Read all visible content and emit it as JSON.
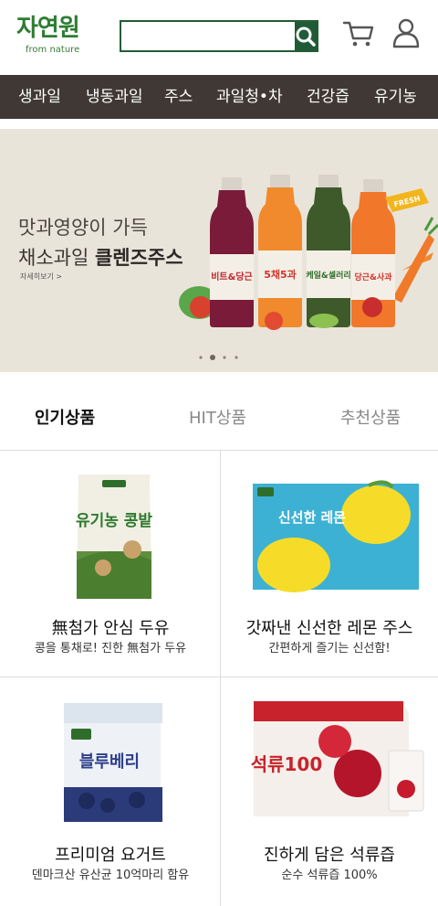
{
  "header": {
    "logo_main": "자연원",
    "logo_sub": "from nature",
    "search_placeholder": "",
    "search_value": ""
  },
  "nav": {
    "items": [
      "생과일",
      "냉동과일",
      "주스",
      "과일청•차",
      "건강즙",
      "유기농"
    ]
  },
  "banner": {
    "line1": "맛과영양이 가득",
    "line2_prefix": "채소과일 ",
    "line2_bold": "클렌즈주스",
    "more": "자세히보기 >",
    "bottle_labels": [
      "비트&당근",
      "5채5과",
      "케일&셀러리",
      "당근&사과"
    ],
    "fresh_tag": "FRESH",
    "slide_count": 4,
    "active_slide": 2
  },
  "tabs": {
    "items": [
      "인기상품",
      "HIT상품",
      "추천상품"
    ],
    "active": 0
  },
  "products": [
    {
      "name": "無첨가 안심 두유",
      "desc": "콩을 통채로! 진한 無첨가 두유",
      "pack_text": "유기농 콩밭"
    },
    {
      "name": "갓짜낸 신선한 레몬 주스",
      "desc": "간편하게 즐기는 신선함!",
      "pack_text": "신선한 레몬"
    },
    {
      "name": "프리미엄 요거트",
      "desc": "덴마크산 유산균 10억마리 함유",
      "pack_text": "블루베리"
    },
    {
      "name": "진하게 담은 석류즙",
      "desc": "순수 석류즙 100%",
      "pack_text": "석류100"
    }
  ],
  "colors": {
    "brand_green": "#1e5b36",
    "nav_bg": "#3f3834",
    "banner_bg": "#e9e4da"
  },
  "icons": [
    "search-icon",
    "cart-icon",
    "user-icon"
  ]
}
